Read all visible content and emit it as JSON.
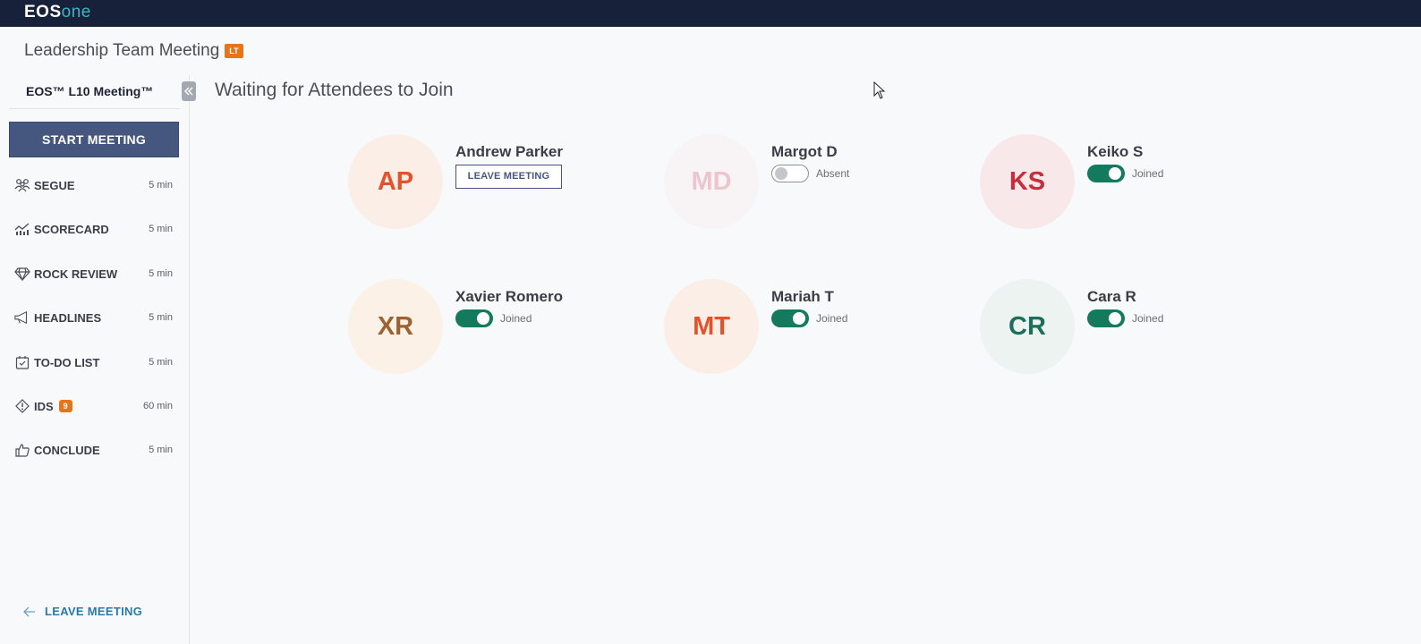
{
  "app": {
    "logo_main": "EOS",
    "logo_suffix": "one"
  },
  "meeting": {
    "title": "Leadership Team Meeting",
    "team_badge": "LT"
  },
  "sidebar": {
    "title": "EOS™ L10 Meeting™",
    "start_button": "START MEETING",
    "items": [
      {
        "label": "SEGUE",
        "time": "5 min",
        "icon": "people-icon"
      },
      {
        "label": "SCORECARD",
        "time": "5 min",
        "icon": "chart-icon"
      },
      {
        "label": "ROCK REVIEW",
        "time": "5 min",
        "icon": "diamond-icon"
      },
      {
        "label": "HEADLINES",
        "time": "5 min",
        "icon": "megaphone-icon"
      },
      {
        "label": "TO-DO LIST",
        "time": "5 min",
        "icon": "calendar-check-icon"
      },
      {
        "label": "IDS",
        "time": "60 min",
        "icon": "issue-icon",
        "badge": "9"
      },
      {
        "label": "CONCLUDE",
        "time": "5 min",
        "icon": "thumbs-up-icon"
      }
    ],
    "leave_link": "LEAVE MEETING"
  },
  "main": {
    "heading": "Waiting for Attendees to Join",
    "attendees": [
      {
        "initials": "AP",
        "name": "Andrew Parker",
        "action": "LEAVE MEETING",
        "avatar_bg": "#fbeee6",
        "avatar_fg": "#e2532c"
      },
      {
        "initials": "MD",
        "name": "Margot D",
        "status": "Absent",
        "joined": false,
        "avatar_bg": "#f8f3f4",
        "avatar_fg": "#ecc6cf"
      },
      {
        "initials": "KS",
        "name": "Keiko S",
        "status": "Joined",
        "joined": true,
        "avatar_bg": "#f8e8ea",
        "avatar_fg": "#c5303d"
      },
      {
        "initials": "XR",
        "name": "Xavier Romero",
        "status": "Joined",
        "joined": true,
        "avatar_bg": "#fbf1e6",
        "avatar_fg": "#9d6232"
      },
      {
        "initials": "MT",
        "name": "Mariah T",
        "status": "Joined",
        "joined": true,
        "avatar_bg": "#fbeee6",
        "avatar_fg": "#e2532c"
      },
      {
        "initials": "CR",
        "name": "Cara R",
        "status": "Joined",
        "joined": true,
        "avatar_bg": "#ecf3f1",
        "avatar_fg": "#1d6f5b"
      }
    ]
  }
}
